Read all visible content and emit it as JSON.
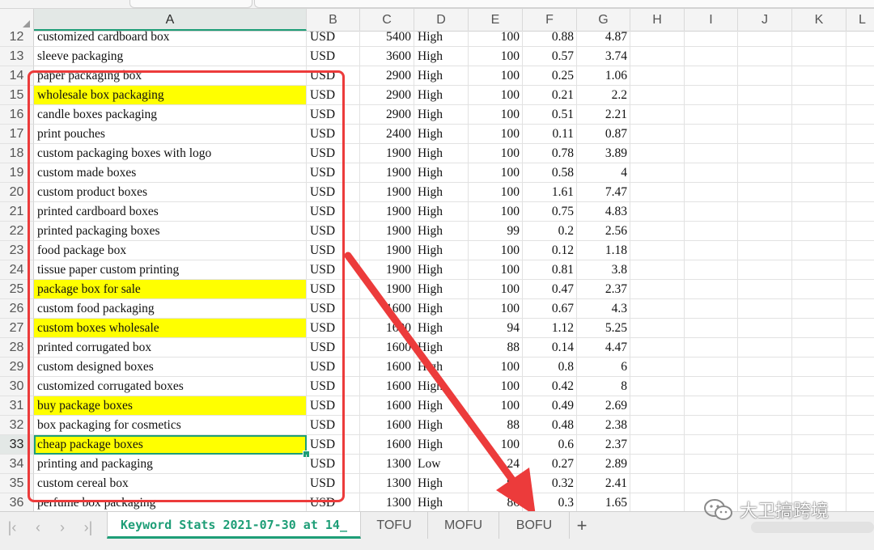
{
  "columns": [
    "A",
    "B",
    "C",
    "D",
    "E",
    "F",
    "G",
    "H",
    "I",
    "J",
    "K",
    "L"
  ],
  "selected_column": "A",
  "rows": [
    {
      "n": "12",
      "a": "customized cardboard box",
      "b": "USD",
      "c": "5400",
      "d": "High",
      "e": "100",
      "f": "0.88",
      "g": "4.87",
      "hl": false
    },
    {
      "n": "13",
      "a": "sleeve packaging",
      "b": "USD",
      "c": "3600",
      "d": "High",
      "e": "100",
      "f": "0.57",
      "g": "3.74",
      "hl": false
    },
    {
      "n": "14",
      "a": "paper packaging box",
      "b": "USD",
      "c": "2900",
      "d": "High",
      "e": "100",
      "f": "0.25",
      "g": "1.06",
      "hl": false
    },
    {
      "n": "15",
      "a": "wholesale box packaging",
      "b": "USD",
      "c": "2900",
      "d": "High",
      "e": "100",
      "f": "0.21",
      "g": "2.2",
      "hl": true
    },
    {
      "n": "16",
      "a": "candle boxes packaging",
      "b": "USD",
      "c": "2900",
      "d": "High",
      "e": "100",
      "f": "0.51",
      "g": "2.21",
      "hl": false
    },
    {
      "n": "17",
      "a": "print pouches",
      "b": "USD",
      "c": "2400",
      "d": "High",
      "e": "100",
      "f": "0.11",
      "g": "0.87",
      "hl": false
    },
    {
      "n": "18",
      "a": "custom packaging boxes with logo",
      "b": "USD",
      "c": "1900",
      "d": "High",
      "e": "100",
      "f": "0.78",
      "g": "3.89",
      "hl": false
    },
    {
      "n": "19",
      "a": "custom made boxes",
      "b": "USD",
      "c": "1900",
      "d": "High",
      "e": "100",
      "f": "0.58",
      "g": "4",
      "hl": false
    },
    {
      "n": "20",
      "a": "custom product boxes",
      "b": "USD",
      "c": "1900",
      "d": "High",
      "e": "100",
      "f": "1.61",
      "g": "7.47",
      "hl": false
    },
    {
      "n": "21",
      "a": "printed cardboard boxes",
      "b": "USD",
      "c": "1900",
      "d": "High",
      "e": "100",
      "f": "0.75",
      "g": "4.83",
      "hl": false
    },
    {
      "n": "22",
      "a": "printed packaging boxes",
      "b": "USD",
      "c": "1900",
      "d": "High",
      "e": "99",
      "f": "0.2",
      "g": "2.56",
      "hl": false
    },
    {
      "n": "23",
      "a": "food package box",
      "b": "USD",
      "c": "1900",
      "d": "High",
      "e": "100",
      "f": "0.12",
      "g": "1.18",
      "hl": false
    },
    {
      "n": "24",
      "a": "tissue paper custom printing",
      "b": "USD",
      "c": "1900",
      "d": "High",
      "e": "100",
      "f": "0.81",
      "g": "3.8",
      "hl": false
    },
    {
      "n": "25",
      "a": "package box for sale",
      "b": "USD",
      "c": "1900",
      "d": "High",
      "e": "100",
      "f": "0.47",
      "g": "2.37",
      "hl": true
    },
    {
      "n": "26",
      "a": "custom food packaging",
      "b": "USD",
      "c": "1600",
      "d": "High",
      "e": "100",
      "f": "0.67",
      "g": "4.3",
      "hl": false
    },
    {
      "n": "27",
      "a": "custom boxes wholesale",
      "b": "USD",
      "c": "1600",
      "d": "High",
      "e": "94",
      "f": "1.12",
      "g": "5.25",
      "hl": true
    },
    {
      "n": "28",
      "a": "printed corrugated box",
      "b": "USD",
      "c": "1600",
      "d": "High",
      "e": "88",
      "f": "0.14",
      "g": "4.47",
      "hl": false
    },
    {
      "n": "29",
      "a": "custom designed boxes",
      "b": "USD",
      "c": "1600",
      "d": "High",
      "e": "100",
      "f": "0.8",
      "g": "6",
      "hl": false
    },
    {
      "n": "30",
      "a": "customized corrugated boxes",
      "b": "USD",
      "c": "1600",
      "d": "High",
      "e": "100",
      "f": "0.42",
      "g": "8",
      "hl": false
    },
    {
      "n": "31",
      "a": "buy package boxes",
      "b": "USD",
      "c": "1600",
      "d": "High",
      "e": "100",
      "f": "0.49",
      "g": "2.69",
      "hl": true
    },
    {
      "n": "32",
      "a": "box packaging for cosmetics",
      "b": "USD",
      "c": "1600",
      "d": "High",
      "e": "88",
      "f": "0.48",
      "g": "2.38",
      "hl": false
    },
    {
      "n": "33",
      "a": "cheap package boxes",
      "b": "USD",
      "c": "1600",
      "d": "High",
      "e": "100",
      "f": "0.6",
      "g": "2.37",
      "hl": true
    },
    {
      "n": "34",
      "a": "printing and packaging",
      "b": "USD",
      "c": "1300",
      "d": "Low",
      "e": "24",
      "f": "0.27",
      "g": "2.89",
      "hl": false
    },
    {
      "n": "35",
      "a": "custom cereal box",
      "b": "USD",
      "c": "1300",
      "d": "High",
      "e": "90",
      "f": "0.32",
      "g": "2.41",
      "hl": false
    },
    {
      "n": "36",
      "a": "perfume box packaging",
      "b": "USD",
      "c": "1300",
      "d": "High",
      "e": "86",
      "f": "0.3",
      "g": "1.65",
      "hl": false
    }
  ],
  "active_cell": "A33",
  "highlight_color": "#ffff00",
  "annotation_color": "#ec3b3b",
  "accent_color": "#1e9e77",
  "sheet_tabs": [
    {
      "label": "Keyword Stats 2021-07-30 at 14_",
      "active": true
    },
    {
      "label": "TOFU",
      "active": false
    },
    {
      "label": "MOFU",
      "active": false
    },
    {
      "label": "BOFU",
      "active": false
    }
  ],
  "add_sheet_label": "+",
  "nav_icons": [
    "first-sheet-icon",
    "prev-sheet-icon",
    "next-sheet-icon",
    "last-sheet-icon"
  ],
  "watermark_text": "大卫搞跨境"
}
